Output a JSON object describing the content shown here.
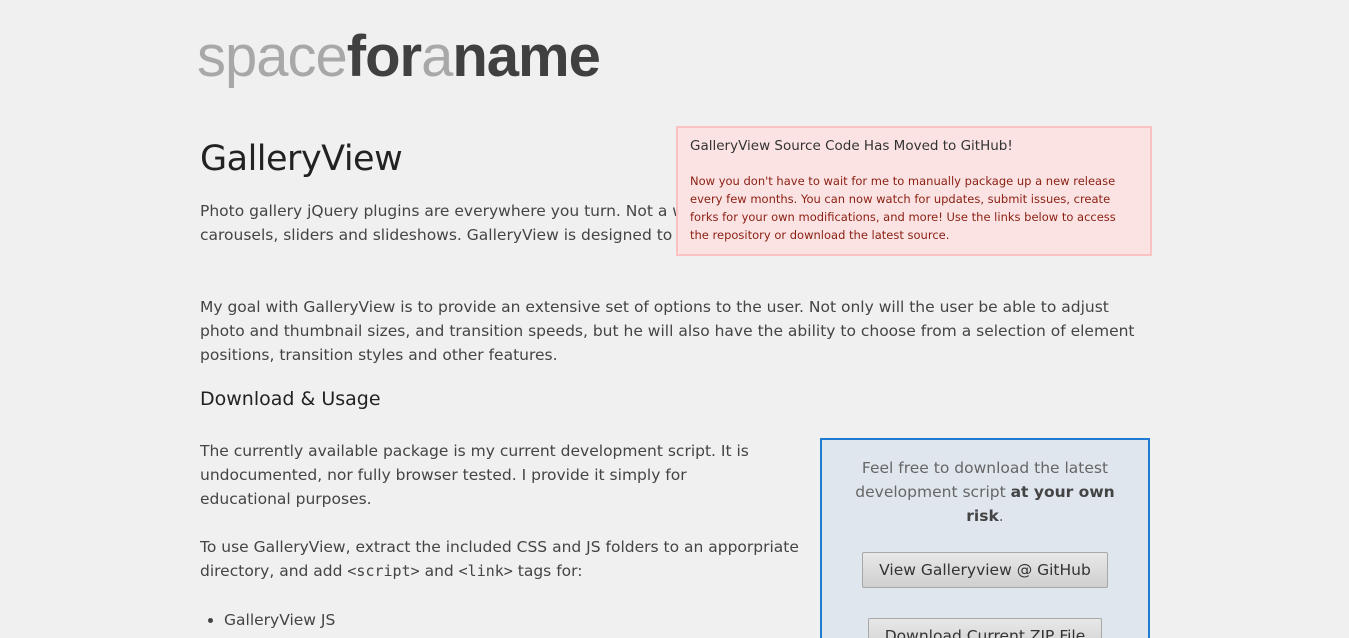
{
  "logo": {
    "part1": "space",
    "part2": "for",
    "part3": "a",
    "part4": "name"
  },
  "page_title": "GalleryView",
  "intro": "Photo gallery jQuery plugins are everywhere you turn. Not a week goes by without a new set of jQuery galleries, carousels, sliders and slideshows. GalleryView is designed to offer a wide variety of gallery types.",
  "goal": "My goal with GalleryView is to provide an extensive set of options to the user. Not only will the user be able to adjust photo and thumbnail sizes, and transition speeds, but he will also have the ability to choose from a selection of element positions, transition styles and other features.",
  "section_heading": "Download & Usage",
  "current_package": "The currently available package is my current development script. It is undocumented, nor fully browser tested. I provide it simply for educational purposes.",
  "usage": {
    "before": "To use GalleryView, extract the included CSS and JS folders to an apporpriate directory, and add ",
    "code1": "<script>",
    "middle": " and ",
    "code2": "<link>",
    "after": " tags for:"
  },
  "bullets": [
    "GalleryView JS"
  ],
  "notice": {
    "title": "GalleryView Source Code Has Moved to GitHub!",
    "body": "Now you don't have to wait for me to manually package up a new release every few months. You can now watch for updates, submit issues, create forks for your own modifications, and more! Use the links below to access the repository or download the latest source."
  },
  "download_box": {
    "text": "Feel free to download the latest development script ",
    "bold": "at your own risk",
    "end": ".",
    "github_button": "View Galleryview @ GitHub",
    "zip_button": "Download Current ZIP File"
  }
}
